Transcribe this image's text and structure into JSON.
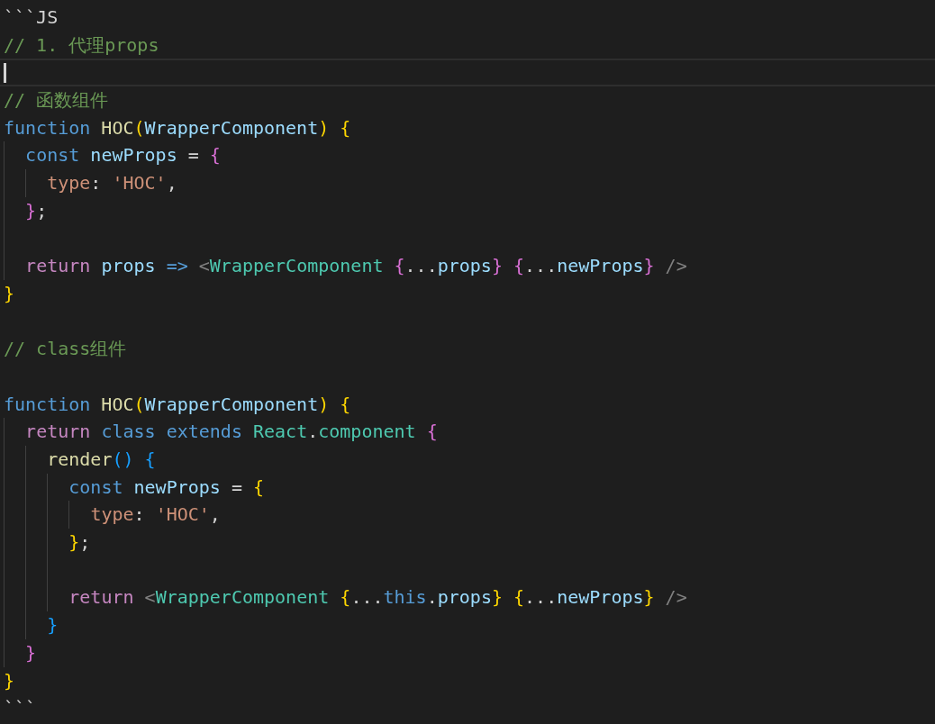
{
  "lines": [
    {
      "tokens": [
        {
          "t": "```JS",
          "kind": "plain"
        }
      ]
    },
    {
      "tokens": [
        {
          "t": "// 1. 代理props",
          "kind": "comment"
        }
      ]
    },
    {
      "current": true
    },
    {
      "tokens": [
        {
          "t": "// 函数组件",
          "kind": "comment"
        }
      ]
    },
    {
      "tokens": [
        {
          "t": "function",
          "kind": "keyword"
        },
        {
          "t": " HOC",
          "kind": "func"
        },
        {
          "t": "(",
          "kind": "b1"
        },
        {
          "t": "WrapperComponent",
          "kind": "var"
        },
        {
          "t": ")",
          "kind": "b1"
        },
        {
          "t": " {",
          "kind": "b1"
        }
      ],
      "children": [
        {
          "tokens": [
            {
              "t": "const",
              "kind": "keyword"
            },
            {
              "t": " newProps",
              "kind": "var"
            },
            {
              "t": " = ",
              "kind": "plain"
            },
            {
              "t": "{",
              "kind": "b2"
            }
          ],
          "children": [
            {
              "tokens": [
                {
                  "t": "type",
                  "kind": "prop"
                },
                {
                  "t": ": ",
                  "kind": "plain"
                },
                {
                  "t": "'HOC'",
                  "kind": "string"
                },
                {
                  "t": ",",
                  "kind": "plain"
                }
              ]
            }
          ]
        },
        {
          "tokens": [
            {
              "t": "}",
              "kind": "b2"
            },
            {
              "t": ";",
              "kind": "plain"
            }
          ]
        },
        {
          "blank_before": true,
          "tokens": [
            {
              "t": "return",
              "kind": "control"
            },
            {
              "t": " props",
              "kind": "var"
            },
            {
              "t": " => ",
              "kind": "keyword"
            },
            {
              "t": "<",
              "kind": "tag"
            },
            {
              "t": "WrapperComponent",
              "kind": "class"
            },
            {
              "t": " {",
              "kind": "b2"
            },
            {
              "t": "...",
              "kind": "plain"
            },
            {
              "t": "props",
              "kind": "var"
            },
            {
              "t": "}",
              "kind": "b2"
            },
            {
              "t": " {",
              "kind": "b2"
            },
            {
              "t": "...",
              "kind": "plain"
            },
            {
              "t": "newProps",
              "kind": "var"
            },
            {
              "t": "}",
              "kind": "b2"
            },
            {
              "t": " />",
              "kind": "tag"
            }
          ]
        }
      ]
    },
    {
      "tokens": [
        {
          "t": "}",
          "kind": "b1"
        }
      ]
    },
    {
      "blank_before": true,
      "tokens": [
        {
          "t": "// class组件",
          "kind": "comment"
        }
      ]
    },
    {
      "blank_before": true,
      "tokens": [
        {
          "t": "function",
          "kind": "keyword"
        },
        {
          "t": " HOC",
          "kind": "func"
        },
        {
          "t": "(",
          "kind": "b1"
        },
        {
          "t": "WrapperComponent",
          "kind": "var"
        },
        {
          "t": ")",
          "kind": "b1"
        },
        {
          "t": " {",
          "kind": "b1"
        }
      ],
      "children": [
        {
          "tokens": [
            {
              "t": "return",
              "kind": "control"
            },
            {
              "t": " class extends ",
              "kind": "keyword"
            },
            {
              "t": "React",
              "kind": "class"
            },
            {
              "t": ".",
              "kind": "plain"
            },
            {
              "t": "component",
              "kind": "class"
            },
            {
              "t": " {",
              "kind": "b2"
            }
          ],
          "children": [
            {
              "tokens": [
                {
                  "t": "render",
                  "kind": "func"
                },
                {
                  "t": "()",
                  "kind": "b3"
                },
                {
                  "t": " {",
                  "kind": "b3"
                }
              ],
              "children": [
                {
                  "tokens": [
                    {
                      "t": "const",
                      "kind": "keyword"
                    },
                    {
                      "t": " newProps",
                      "kind": "var"
                    },
                    {
                      "t": " = ",
                      "kind": "plain"
                    },
                    {
                      "t": "{",
                      "kind": "b1"
                    }
                  ],
                  "children": [
                    {
                      "tokens": [
                        {
                          "t": "type",
                          "kind": "prop"
                        },
                        {
                          "t": ": ",
                          "kind": "plain"
                        },
                        {
                          "t": "'HOC'",
                          "kind": "string"
                        },
                        {
                          "t": ",",
                          "kind": "plain"
                        }
                      ]
                    }
                  ]
                },
                {
                  "tokens": [
                    {
                      "t": "}",
                      "kind": "b1"
                    },
                    {
                      "t": ";",
                      "kind": "plain"
                    }
                  ]
                },
                {
                  "blank_before": true,
                  "tokens": [
                    {
                      "t": "return",
                      "kind": "control"
                    },
                    {
                      "t": " <",
                      "kind": "tag"
                    },
                    {
                      "t": "WrapperComponent",
                      "kind": "class"
                    },
                    {
                      "t": " {",
                      "kind": "b1"
                    },
                    {
                      "t": "...",
                      "kind": "plain"
                    },
                    {
                      "t": "this",
                      "kind": "keyword"
                    },
                    {
                      "t": ".",
                      "kind": "plain"
                    },
                    {
                      "t": "props",
                      "kind": "var"
                    },
                    {
                      "t": "}",
                      "kind": "b1"
                    },
                    {
                      "t": " {",
                      "kind": "b1"
                    },
                    {
                      "t": "...",
                      "kind": "plain"
                    },
                    {
                      "t": "newProps",
                      "kind": "var"
                    },
                    {
                      "t": "}",
                      "kind": "b1"
                    },
                    {
                      "t": " />",
                      "kind": "tag"
                    }
                  ]
                }
              ]
            },
            {
              "tokens": [
                {
                  "t": "}",
                  "kind": "b3"
                }
              ]
            }
          ]
        },
        {
          "tokens": [
            {
              "t": "}",
              "kind": "b2"
            }
          ]
        }
      ]
    },
    {
      "tokens": [
        {
          "t": "}",
          "kind": "b1"
        }
      ]
    },
    {
      "tokens": [
        {
          "t": "```",
          "kind": "plain"
        }
      ]
    }
  ]
}
